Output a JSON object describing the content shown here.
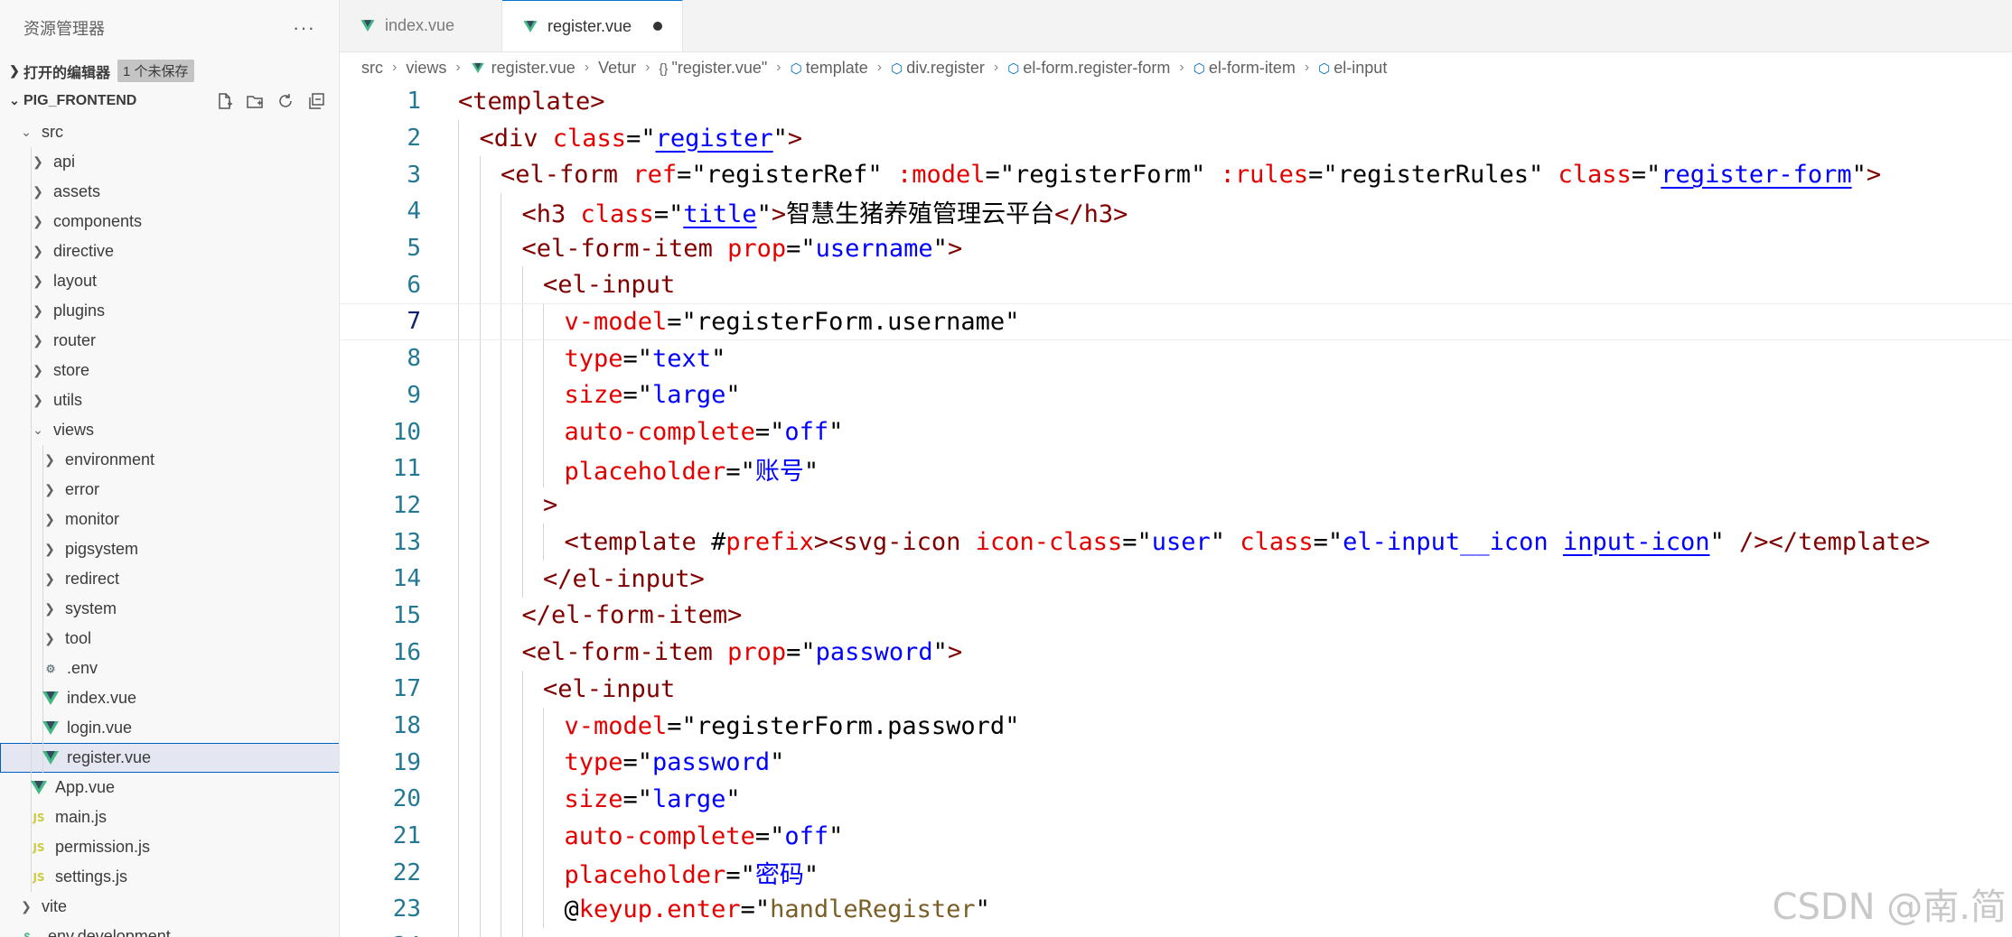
{
  "explorer": {
    "title": "资源管理器",
    "more": "···",
    "open_editors": {
      "label": "打开的编辑器",
      "badge": "1 个未保存"
    },
    "project": {
      "label": "PIG_FRONTEND"
    },
    "tree": [
      {
        "label": "src",
        "kind": "folder-open",
        "depth": 0
      },
      {
        "label": "api",
        "kind": "folder",
        "depth": 1
      },
      {
        "label": "assets",
        "kind": "folder",
        "depth": 1
      },
      {
        "label": "components",
        "kind": "folder",
        "depth": 1
      },
      {
        "label": "directive",
        "kind": "folder",
        "depth": 1
      },
      {
        "label": "layout",
        "kind": "folder",
        "depth": 1
      },
      {
        "label": "plugins",
        "kind": "folder",
        "depth": 1
      },
      {
        "label": "router",
        "kind": "folder",
        "depth": 1
      },
      {
        "label": "store",
        "kind": "folder",
        "depth": 1
      },
      {
        "label": "utils",
        "kind": "folder",
        "depth": 1
      },
      {
        "label": "views",
        "kind": "folder-open",
        "depth": 1
      },
      {
        "label": "environment",
        "kind": "folder",
        "depth": 2
      },
      {
        "label": "error",
        "kind": "folder",
        "depth": 2
      },
      {
        "label": "monitor",
        "kind": "folder",
        "depth": 2
      },
      {
        "label": "pigsystem",
        "kind": "folder",
        "depth": 2
      },
      {
        "label": "redirect",
        "kind": "folder",
        "depth": 2
      },
      {
        "label": "system",
        "kind": "folder",
        "depth": 2
      },
      {
        "label": "tool",
        "kind": "folder",
        "depth": 2
      },
      {
        "label": ".env",
        "kind": "gear",
        "depth": 2
      },
      {
        "label": "index.vue",
        "kind": "vue",
        "depth": 2
      },
      {
        "label": "login.vue",
        "kind": "vue",
        "depth": 2
      },
      {
        "label": "register.vue",
        "kind": "vue",
        "depth": 2,
        "selected": true
      },
      {
        "label": "App.vue",
        "kind": "vue",
        "depth": 1
      },
      {
        "label": "main.js",
        "kind": "js",
        "depth": 1
      },
      {
        "label": "permission.js",
        "kind": "js",
        "depth": 1
      },
      {
        "label": "settings.js",
        "kind": "js",
        "depth": 1
      },
      {
        "label": "vite",
        "kind": "folder",
        "depth": 0
      },
      {
        "label": ".env.development",
        "kind": "env",
        "depth": 0
      }
    ]
  },
  "tabs": [
    {
      "label": "index.vue",
      "active": false
    },
    {
      "label": "register.vue",
      "active": true,
      "dirty": true
    }
  ],
  "breadcrumbs": [
    {
      "label": "src",
      "icon": ""
    },
    {
      "label": "views",
      "icon": ""
    },
    {
      "label": "register.vue",
      "icon": "vue"
    },
    {
      "label": "Vetur",
      "icon": ""
    },
    {
      "label": "\"register.vue\"",
      "icon": "{}"
    },
    {
      "label": "template",
      "icon": "cube"
    },
    {
      "label": "div.register",
      "icon": "cube"
    },
    {
      "label": "el-form.register-form",
      "icon": "cube"
    },
    {
      "label": "el-form-item",
      "icon": "cube"
    },
    {
      "label": "el-input",
      "icon": "cube"
    }
  ],
  "editor": {
    "current_line": 7,
    "lines": [
      {
        "n": "1",
        "indent": 0,
        "tokens": [
          [
            "t-tag",
            "<template>"
          ]
        ]
      },
      {
        "n": "2",
        "indent": 1,
        "tokens": [
          [
            "t-tag",
            "<div "
          ],
          [
            "t-attr",
            "class"
          ],
          [
            "t-punct",
            "=\""
          ],
          [
            "t-str t-link",
            "register"
          ],
          [
            "t-punct",
            "\""
          ],
          [
            "t-tag",
            ">"
          ]
        ]
      },
      {
        "n": "3",
        "indent": 2,
        "tokens": [
          [
            "t-tag",
            "<el-form "
          ],
          [
            "t-attr",
            "ref"
          ],
          [
            "t-punct",
            "=\""
          ],
          [
            "t-txt",
            "registerRef"
          ],
          [
            "t-punct",
            "\" "
          ],
          [
            "t-attr",
            ":model"
          ],
          [
            "t-punct",
            "=\""
          ],
          [
            "t-txt",
            "registerForm"
          ],
          [
            "t-punct",
            "\" "
          ],
          [
            "t-attr",
            ":rules"
          ],
          [
            "t-punct",
            "=\""
          ],
          [
            "t-txt",
            "registerRules"
          ],
          [
            "t-punct",
            "\" "
          ],
          [
            "t-attr",
            "class"
          ],
          [
            "t-punct",
            "=\""
          ],
          [
            "t-str t-link",
            "register-form"
          ],
          [
            "t-punct",
            "\""
          ],
          [
            "t-tag",
            ">"
          ]
        ]
      },
      {
        "n": "4",
        "indent": 3,
        "tokens": [
          [
            "t-tag",
            "<h3 "
          ],
          [
            "t-attr",
            "class"
          ],
          [
            "t-punct",
            "=\""
          ],
          [
            "t-str t-link",
            "title"
          ],
          [
            "t-punct",
            "\""
          ],
          [
            "t-tag",
            ">"
          ],
          [
            "t-txt",
            "智慧生猪养殖管理云平台"
          ],
          [
            "t-tag",
            "</h3>"
          ]
        ]
      },
      {
        "n": "5",
        "indent": 3,
        "tokens": [
          [
            "t-tag",
            "<el-form-item "
          ],
          [
            "t-attr",
            "prop"
          ],
          [
            "t-punct",
            "=\""
          ],
          [
            "t-str",
            "username"
          ],
          [
            "t-punct",
            "\""
          ],
          [
            "t-tag",
            ">"
          ]
        ]
      },
      {
        "n": "6",
        "indent": 4,
        "tokens": [
          [
            "t-tag",
            "<el-input"
          ]
        ]
      },
      {
        "n": "7",
        "indent": 5,
        "tokens": [
          [
            "t-attr",
            "v-model"
          ],
          [
            "t-punct",
            "=\""
          ],
          [
            "t-txt",
            "registerForm.username"
          ],
          [
            "t-punct",
            "\""
          ]
        ]
      },
      {
        "n": "8",
        "indent": 5,
        "tokens": [
          [
            "t-attr",
            "type"
          ],
          [
            "t-punct",
            "=\""
          ],
          [
            "t-str",
            "text"
          ],
          [
            "t-punct",
            "\""
          ]
        ]
      },
      {
        "n": "9",
        "indent": 5,
        "tokens": [
          [
            "t-attr",
            "size"
          ],
          [
            "t-punct",
            "=\""
          ],
          [
            "t-str",
            "large"
          ],
          [
            "t-punct",
            "\""
          ]
        ]
      },
      {
        "n": "10",
        "indent": 5,
        "tokens": [
          [
            "t-attr",
            "auto-complete"
          ],
          [
            "t-punct",
            "=\""
          ],
          [
            "t-str",
            "off"
          ],
          [
            "t-punct",
            "\""
          ]
        ]
      },
      {
        "n": "11",
        "indent": 5,
        "tokens": [
          [
            "t-attr",
            "placeholder"
          ],
          [
            "t-punct",
            "=\""
          ],
          [
            "t-str",
            "账号"
          ],
          [
            "t-punct",
            "\""
          ]
        ]
      },
      {
        "n": "12",
        "indent": 4,
        "tokens": [
          [
            "t-tag",
            ">"
          ]
        ]
      },
      {
        "n": "13",
        "indent": 5,
        "tokens": [
          [
            "t-tag",
            "<template "
          ],
          [
            "t-punct",
            "#"
          ],
          [
            "t-attr",
            "prefix"
          ],
          [
            "t-tag",
            "><svg-icon "
          ],
          [
            "t-attr",
            "icon-class"
          ],
          [
            "t-punct",
            "=\""
          ],
          [
            "t-str",
            "user"
          ],
          [
            "t-punct",
            "\" "
          ],
          [
            "t-attr",
            "class"
          ],
          [
            "t-punct",
            "=\""
          ],
          [
            "t-str",
            "el-input__icon "
          ],
          [
            "t-str t-link",
            "input-icon"
          ],
          [
            "t-punct",
            "\" "
          ],
          [
            "t-tag",
            "/></template>"
          ]
        ]
      },
      {
        "n": "14",
        "indent": 4,
        "tokens": [
          [
            "t-tag",
            "</el-input>"
          ]
        ]
      },
      {
        "n": "15",
        "indent": 3,
        "tokens": [
          [
            "t-tag",
            "</el-form-item>"
          ]
        ]
      },
      {
        "n": "16",
        "indent": 3,
        "tokens": [
          [
            "t-tag",
            "<el-form-item "
          ],
          [
            "t-attr",
            "prop"
          ],
          [
            "t-punct",
            "=\""
          ],
          [
            "t-str",
            "password"
          ],
          [
            "t-punct",
            "\""
          ],
          [
            "t-tag",
            ">"
          ]
        ]
      },
      {
        "n": "17",
        "indent": 4,
        "tokens": [
          [
            "t-tag",
            "<el-input"
          ]
        ]
      },
      {
        "n": "18",
        "indent": 5,
        "tokens": [
          [
            "t-attr",
            "v-model"
          ],
          [
            "t-punct",
            "=\""
          ],
          [
            "t-txt",
            "registerForm.password"
          ],
          [
            "t-punct",
            "\""
          ]
        ]
      },
      {
        "n": "19",
        "indent": 5,
        "tokens": [
          [
            "t-attr",
            "type"
          ],
          [
            "t-punct",
            "=\""
          ],
          [
            "t-str",
            "password"
          ],
          [
            "t-punct",
            "\""
          ]
        ]
      },
      {
        "n": "20",
        "indent": 5,
        "tokens": [
          [
            "t-attr",
            "size"
          ],
          [
            "t-punct",
            "=\""
          ],
          [
            "t-str",
            "large"
          ],
          [
            "t-punct",
            "\""
          ]
        ]
      },
      {
        "n": "21",
        "indent": 5,
        "tokens": [
          [
            "t-attr",
            "auto-complete"
          ],
          [
            "t-punct",
            "=\""
          ],
          [
            "t-str",
            "off"
          ],
          [
            "t-punct",
            "\""
          ]
        ]
      },
      {
        "n": "22",
        "indent": 5,
        "tokens": [
          [
            "t-attr",
            "placeholder"
          ],
          [
            "t-punct",
            "=\""
          ],
          [
            "t-str",
            "密码"
          ],
          [
            "t-punct",
            "\""
          ]
        ]
      },
      {
        "n": "23",
        "indent": 5,
        "tokens": [
          [
            "t-punct",
            "@"
          ],
          [
            "t-attr",
            "keyup.enter"
          ],
          [
            "t-punct",
            "=\""
          ],
          [
            "t-ev",
            "handleRegister"
          ],
          [
            "t-punct",
            "\""
          ]
        ]
      },
      {
        "n": "24",
        "indent": 4,
        "tokens": [
          [
            "t-tag",
            ">"
          ]
        ]
      }
    ]
  },
  "watermark": "CSDN @南.简"
}
